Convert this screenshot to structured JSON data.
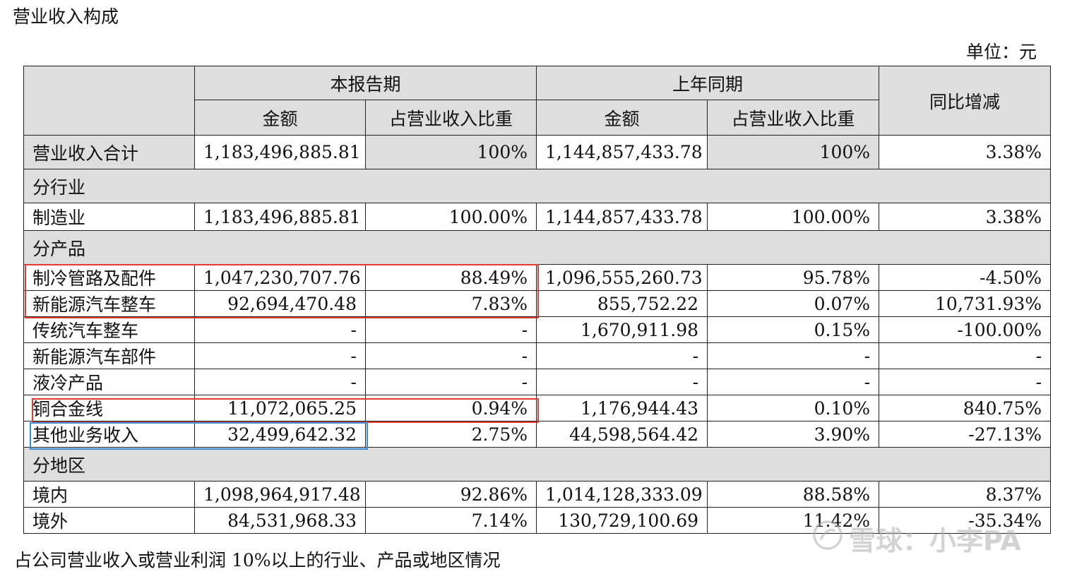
{
  "title": "营业收入构成",
  "unit": "单位：元",
  "header": {
    "current_period": "本报告期",
    "prior_period": "上年同期",
    "yoy": "同比增减",
    "amount": "金额",
    "share": "占营业收入比重"
  },
  "total": {
    "label": "营业收入合计",
    "cur_amt": "1,183,496,885.81",
    "cur_pct": "100%",
    "pri_amt": "1,144,857,433.78",
    "pri_pct": "100%",
    "yoy": "3.38%"
  },
  "sections": {
    "industry": "分行业",
    "product": "分产品",
    "region": "分地区"
  },
  "rows": [
    {
      "label": "制造业",
      "cur_amt": "1,183,496,885.81",
      "cur_pct": "100.00%",
      "pri_amt": "1,144,857,433.78",
      "pri_pct": "100.00%",
      "yoy": "3.38%"
    },
    {
      "label": "制冷管路及配件",
      "cur_amt": "1,047,230,707.76",
      "cur_pct": "88.49%",
      "pri_amt": "1,096,555,260.73",
      "pri_pct": "95.78%",
      "yoy": "-4.50%"
    },
    {
      "label": "新能源汽车整车",
      "cur_amt": "92,694,470.48",
      "cur_pct": "7.83%",
      "pri_amt": "855,752.22",
      "pri_pct": "0.07%",
      "yoy": "10,731.93%"
    },
    {
      "label": "传统汽车整车",
      "cur_amt": "-",
      "cur_pct": "-",
      "pri_amt": "1,670,911.98",
      "pri_pct": "0.15%",
      "yoy": "-100.00%"
    },
    {
      "label": "新能源汽车部件",
      "cur_amt": "-",
      "cur_pct": "-",
      "pri_amt": "-",
      "pri_pct": "-",
      "yoy": "-"
    },
    {
      "label": "液冷产品",
      "cur_amt": "-",
      "cur_pct": "-",
      "pri_amt": "-",
      "pri_pct": "-",
      "yoy": "-"
    },
    {
      "label": "铜合金线",
      "cur_amt": "11,072,065.25",
      "cur_pct": "0.94%",
      "pri_amt": "1,176,944.43",
      "pri_pct": "0.10%",
      "yoy": "840.75%"
    },
    {
      "label": "其他业务收入",
      "cur_amt": "32,499,642.32",
      "cur_pct": "2.75%",
      "pri_amt": "44,598,564.42",
      "pri_pct": "3.90%",
      "yoy": "-27.13%"
    },
    {
      "label": "境内",
      "cur_amt": "1,098,964,917.48",
      "cur_pct": "92.86%",
      "pri_amt": "1,014,128,333.09",
      "pri_pct": "88.58%",
      "yoy": "8.37%"
    },
    {
      "label": "境外",
      "cur_amt": "84,531,968.33",
      "cur_pct": "7.14%",
      "pri_amt": "130,729,100.69",
      "pri_pct": "11.42%",
      "yoy": "-35.34%"
    }
  ],
  "footnote": "占公司营业收入或营业利润 10%以上的行业、产品或地区情况",
  "watermark": "雪球：小李PA",
  "colors": {
    "header_bg": "#dedede",
    "highlight_red": "#e23a2c",
    "highlight_blue": "#3a8ad4"
  }
}
